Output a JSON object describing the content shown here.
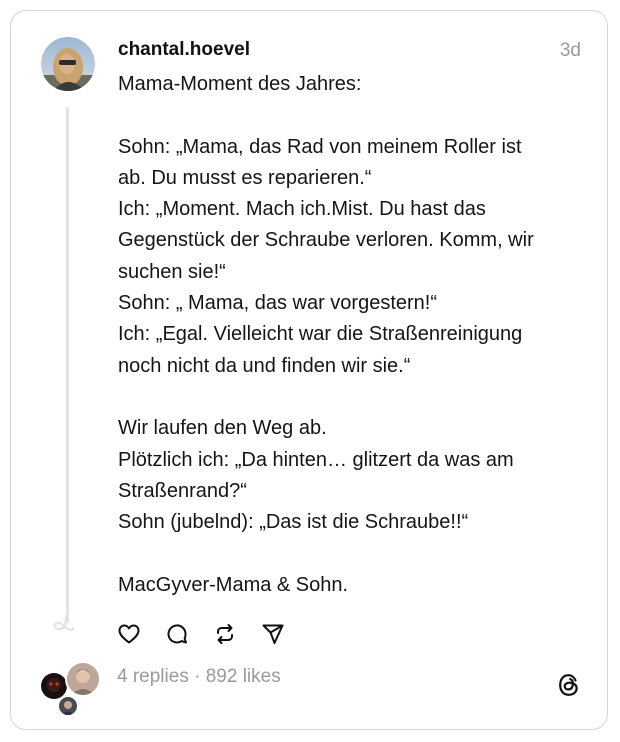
{
  "post": {
    "username": "chantal.hoevel",
    "timestamp": "3d",
    "lines": [
      "Mama-Moment des Jahres:",
      "",
      "Sohn: „Mama, das Rad von meinem Roller ist",
      "ab. Du musst es reparieren.“",
      "Ich: „Moment. Mach ich.Mist. Du hast das",
      "Gegenstück der Schraube verloren. Komm, wir",
      "suchen sie!“",
      "Sohn: „ Mama, das war vorgestern!“",
      "Ich: „Egal. Vielleicht war die Straßenreinigung",
      "noch nicht da und finden wir sie.“",
      "",
      "Wir laufen den Weg ab.",
      "Plötzlich ich: „Da hinten… glitzert da was am",
      "Straßenrand?“",
      "Sohn (jubelnd): „Das ist die Schraube!!“",
      "",
      "MacGyver-Mama & Sohn."
    ]
  },
  "actions": [
    "heart-icon",
    "comment-icon",
    "repost-icon",
    "share-icon"
  ],
  "stats": {
    "replies": "4 replies",
    "separator": " · ",
    "likes": "892 likes"
  },
  "colors": {
    "text": "#151515",
    "muted": "#9a9a9a",
    "border": "#d6d6d6",
    "thread_line": "#e3e3e3"
  }
}
